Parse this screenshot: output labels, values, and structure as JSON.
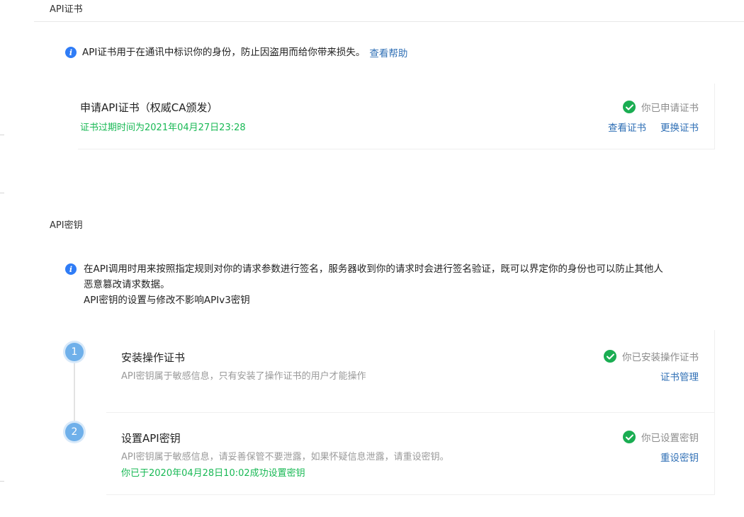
{
  "cert_section": {
    "title": "API证书",
    "info_text": "API证书用于在通讯中标识你的身份，防止因盗用而给你带来损失。",
    "help_link": "查看帮助",
    "card": {
      "title": "申请API证书（权威CA颁发）",
      "expiry": "证书过期时间为2021年04月27日23:28",
      "status": "你已申请证书",
      "view_link": "查看证书",
      "replace_link": "更换证书"
    }
  },
  "key_section": {
    "title": "API密钥",
    "info_line1": "在API调用时用来按照指定规则对你的请求参数进行签名，服务器收到你的请求时会进行签名验证，既可以界定你的身份也可以防止其他人",
    "info_line2": "恶意篡改请求数据。",
    "info_line3": "API密钥的设置与修改不影响APIv3密钥",
    "steps": [
      {
        "number": "1",
        "title": "安装操作证书",
        "desc": "API密钥属于敏感信息，只有安装了操作证书的用户才能操作",
        "status": "你已安装操作证书",
        "link": "证书管理"
      },
      {
        "number": "2",
        "title": "设置API密钥",
        "desc": "API密钥属于敏感信息，请妥善保管不要泄露，如果怀疑信息泄露，请重设密钥。",
        "note": "你已于2020年04月28日10:02成功设置密钥",
        "status": "你已设置密钥",
        "link": "重设密钥"
      }
    ]
  },
  "icons": {
    "info": "info-icon",
    "check": "check-circle-icon"
  },
  "colors": {
    "link": "#2f6fb5",
    "success": "#19b955",
    "info": "#2f7cf6",
    "step": "#6fb0ea"
  }
}
